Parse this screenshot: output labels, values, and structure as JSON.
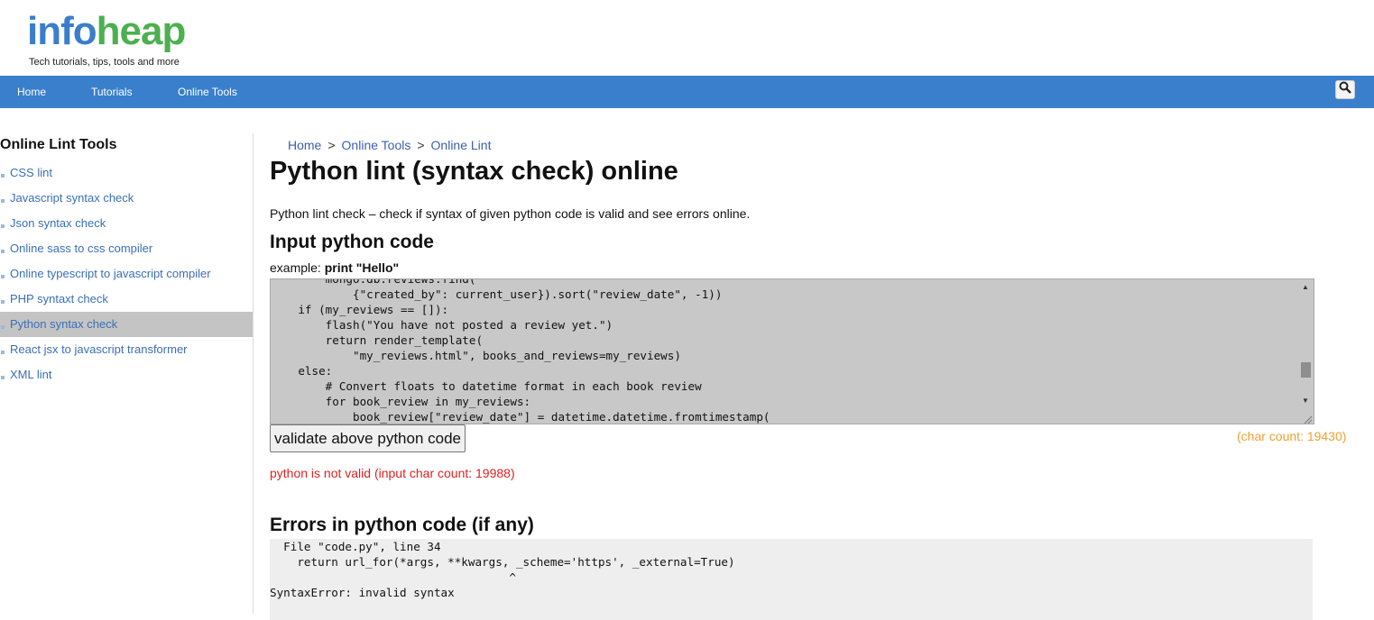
{
  "brand": {
    "logo_part1": "info",
    "logo_part2": "heap",
    "tagline": "Tech tutorials, tips, tools and more",
    "logo_color_info": "#3a7ecb",
    "logo_color_heap": "#4caf50"
  },
  "nav": {
    "items": [
      "Home",
      "Tutorials",
      "Online Tools"
    ],
    "search_icon": "search-icon",
    "background": "#3a7fcb"
  },
  "sidebar": {
    "title": "Online Lint Tools",
    "items": [
      {
        "label": "CSS lint"
      },
      {
        "label": "Javascript syntax check"
      },
      {
        "label": "Json syntax check"
      },
      {
        "label": "Online sass to css compiler"
      },
      {
        "label": "Online typescript to javascript compiler"
      },
      {
        "label": "PHP syntaxt check"
      },
      {
        "label": "Python syntax check",
        "active": true
      },
      {
        "label": "React jsx to javascript transformer"
      },
      {
        "label": "XML lint"
      }
    ]
  },
  "breadcrumb": [
    "Home",
    "Online Tools",
    "Online Lint"
  ],
  "main": {
    "title": "Python lint (syntax check) online",
    "intro": "Python lint check – check if syntax of given python code is valid and see errors online.",
    "input_heading": "Input python code",
    "example_prefix": "example: ",
    "example_code": "print \"Hello\"",
    "code_lines": [
      "        mongo.db.reviews.find(",
      "            {\"created_by\": current_user}).sort(\"review_date\", -1))",
      "    if (my_reviews == []):",
      "        flash(\"You have not posted a review yet.\")",
      "        return render_template(",
      "            \"my_reviews.html\", books_and_reviews=my_reviews)",
      "    else:",
      "        # Convert floats to datetime format in each book review",
      "        for book_review in my_reviews:",
      "            book_review[\"review_date\"] = datetime.datetime.fromtimestamp("
    ],
    "validate_button": "validate above python code",
    "char_count": "(char count: 19430)",
    "status_message": "python is not valid (input char count: 19988)",
    "errors_heading": "Errors in python code (if any)",
    "error_lines": [
      "  File \"code.py\", line 34",
      "    return url_for(*args, **kwargs, _scheme='https', _external=True)",
      "                                   ^",
      "SyntaxError: invalid syntax"
    ],
    "colors": {
      "char_count": "#f0a030",
      "status_error": "#dd2222",
      "link": "#3b5fb0"
    }
  }
}
